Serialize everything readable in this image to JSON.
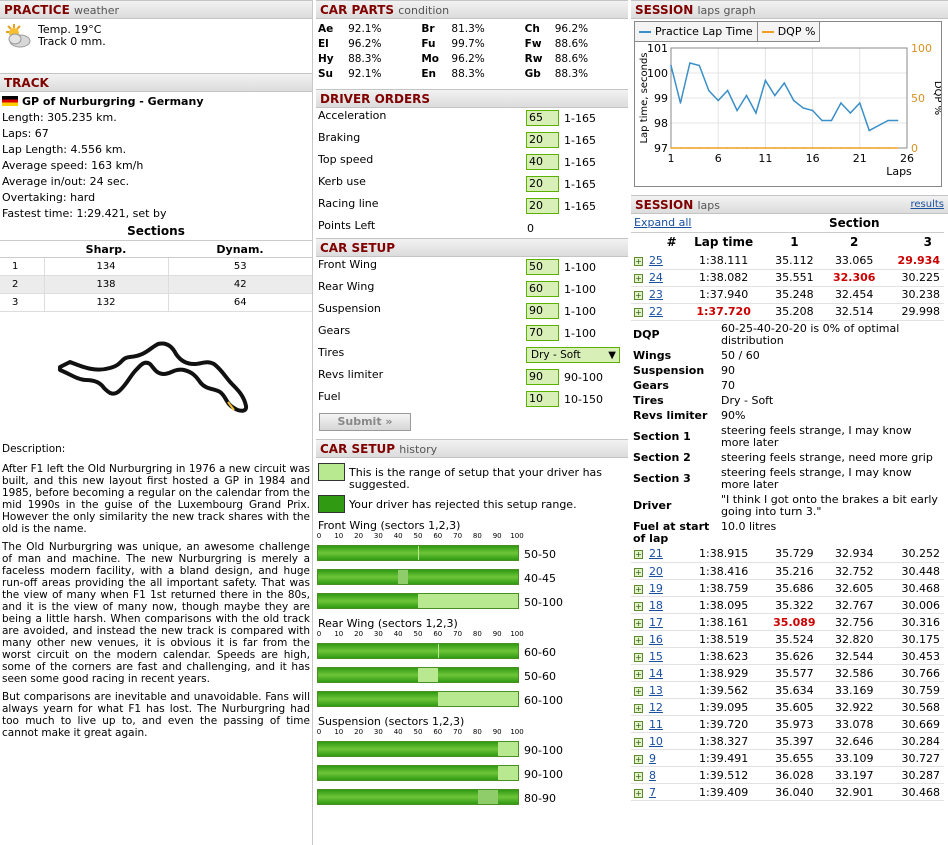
{
  "practice": {
    "title": "PRACTICE",
    "subtitle": "weather",
    "temp": "Temp. 19°C",
    "track": "Track 0 mm."
  },
  "track": {
    "title": "TRACK",
    "name": "GP of Nurburgring - Germany",
    "lines": [
      "Length: 305.235 km.",
      "Laps: 67",
      "Lap Length: 4.556 km.",
      "Average speed: 163 km/h",
      "Average in/out: 24 sec.",
      "Overtaking: hard",
      "Fastest time: 1:29.421, set by"
    ],
    "sections_title": "Sections",
    "sections_headers": [
      "",
      "Sharp.",
      "Dynam."
    ],
    "sections": [
      {
        "n": "1",
        "sharp": "134",
        "dynam": "53"
      },
      {
        "n": "2",
        "sharp": "138",
        "dynam": "42"
      },
      {
        "n": "3",
        "sharp": "132",
        "dynam": "64"
      }
    ],
    "description_label": "Description:",
    "description": [
      "After F1 left the Old Nurburgring in 1976 a new circuit was built, and this new layout first hosted a GP in 1984 and 1985, before becoming a regular on the calendar from the mid 1990s in the guise of the Luxembourg Grand Prix. However the only similarity the new track shares with the old is the name.",
      "The Old Nurburgring was unique, an awesome challenge of man and machine. The new Nurburgring is merely a faceless modern facility, with a bland design, and huge run-off areas providing the all important safety. That was the view of many when F1 1st returned there in the 80s, and it is the view of many now, though maybe they are being a little harsh. When comparisons with the old track are avoided, and instead the new track is compared with many other new venues, it is obvious it is far from the worst circuit on the modern calendar. Speeds are high, some of the corners are fast and challenging, and it has seen some good racing in recent years.",
      "But comparisons are inevitable and unavoidable. Fans will always yearn for what F1 has lost. The Nurburgring had too much to live up to, and even the passing of time cannot make it great again."
    ]
  },
  "car_parts": {
    "title": "CAR PARTS",
    "subtitle": "condition",
    "rows": [
      [
        {
          "k": "Ae",
          "v": "92.1%"
        },
        {
          "k": "Br",
          "v": "81.3%"
        },
        {
          "k": "Ch",
          "v": "96.2%"
        }
      ],
      [
        {
          "k": "El",
          "v": "96.2%"
        },
        {
          "k": "Fu",
          "v": "99.7%"
        },
        {
          "k": "Fw",
          "v": "88.6%"
        }
      ],
      [
        {
          "k": "Hy",
          "v": "88.3%"
        },
        {
          "k": "Mo",
          "v": "96.2%"
        },
        {
          "k": "Rw",
          "v": "88.6%"
        }
      ],
      [
        {
          "k": "Su",
          "v": "92.1%"
        },
        {
          "k": "En",
          "v": "88.3%"
        },
        {
          "k": "Gb",
          "v": "88.3%"
        }
      ]
    ]
  },
  "driver_orders": {
    "title": "DRIVER ORDERS",
    "rows": [
      {
        "label": "Acceleration",
        "value": "65",
        "range": "1-165"
      },
      {
        "label": "Braking",
        "value": "20",
        "range": "1-165"
      },
      {
        "label": "Top speed",
        "value": "40",
        "range": "1-165"
      },
      {
        "label": "Kerb use",
        "value": "20",
        "range": "1-165"
      },
      {
        "label": "Racing line",
        "value": "20",
        "range": "1-165"
      }
    ],
    "points_left_label": "Points Left",
    "points_left": "0"
  },
  "car_setup": {
    "title": "CAR SETUP",
    "rows": [
      {
        "label": "Front Wing",
        "value": "50",
        "range": "1-100"
      },
      {
        "label": "Rear Wing",
        "value": "60",
        "range": "1-100"
      },
      {
        "label": "Suspension",
        "value": "90",
        "range": "1-100"
      },
      {
        "label": "Gears",
        "value": "70",
        "range": "1-100"
      }
    ],
    "tires_label": "Tires",
    "tires_value": "Dry - Soft",
    "rows2": [
      {
        "label": "Revs limiter",
        "value": "90",
        "range": "90-100"
      },
      {
        "label": "Fuel",
        "value": "10",
        "range": "10-150"
      }
    ],
    "submit": "Submit »"
  },
  "setup_history": {
    "title": "CAR SETUP",
    "subtitle": "history",
    "legend_range": "This is the range of setup that your driver has suggested.",
    "legend_rejected": "Your driver has rejected this setup range.",
    "scale": [
      "0",
      "10",
      "20",
      "30",
      "40",
      "50",
      "60",
      "70",
      "80",
      "90",
      "100"
    ],
    "groups": [
      {
        "title": "Front Wing (sectors 1,2,3)",
        "bars": [
          {
            "label": "50-50",
            "range": [
              50,
              50
            ],
            "rejected": null
          },
          {
            "label": "40-45",
            "range": null,
            "rejected": [
              40,
              45
            ]
          },
          {
            "label": "50-100",
            "range": [
              50,
              100
            ],
            "rejected": null
          }
        ]
      },
      {
        "title": "Rear Wing (sectors 1,2,3)",
        "bars": [
          {
            "label": "60-60",
            "range": [
              60,
              60
            ],
            "rejected": null
          },
          {
            "label": "50-60",
            "range": [
              50,
              60
            ],
            "rejected": null
          },
          {
            "label": "60-100",
            "range": [
              60,
              100
            ],
            "rejected": null
          }
        ]
      },
      {
        "title": "Suspension (sectors 1,2,3)",
        "bars": [
          {
            "label": "90-100",
            "range": [
              90,
              100
            ],
            "rejected": null
          },
          {
            "label": "90-100",
            "range": [
              90,
              100
            ],
            "rejected": null
          },
          {
            "label": "80-90",
            "range": null,
            "rejected": [
              80,
              90
            ]
          }
        ]
      }
    ]
  },
  "session_graph": {
    "title": "SESSION",
    "subtitle": "laps graph",
    "legend": [
      {
        "name": "Practice Lap Time",
        "color": "#3a8fc8"
      },
      {
        "name": "DQP %",
        "color": "#f0a020"
      }
    ]
  },
  "chart_data": {
    "type": "line",
    "xlabel": "Laps",
    "ylabel": "Lap time, seconds",
    "y2label": "DQP %",
    "xlim": [
      1,
      26
    ],
    "ylim": [
      97,
      101
    ],
    "y2lim": [
      0,
      100
    ],
    "xticks": [
      1,
      6,
      11,
      16,
      21,
      26
    ],
    "yticks": [
      97,
      98,
      99,
      100,
      101
    ],
    "y2ticks": [
      0,
      50,
      100
    ],
    "series": [
      {
        "name": "Practice Lap Time",
        "axis": "left",
        "color": "#3a8fc8",
        "x": [
          1,
          2,
          3,
          4,
          5,
          6,
          7,
          8,
          9,
          10,
          11,
          12,
          13,
          14,
          15,
          16,
          17,
          18,
          19,
          20,
          21,
          22,
          23,
          24,
          25
        ],
        "y": [
          100.3,
          98.8,
          100.4,
          100.3,
          99.3,
          98.9,
          99.3,
          98.5,
          99.1,
          98.4,
          99.7,
          99.1,
          99.6,
          98.9,
          98.6,
          98.5,
          98.1,
          98.1,
          98.8,
          98.4,
          98.8,
          97.7,
          97.9,
          98.1,
          98.1
        ]
      },
      {
        "name": "DQP %",
        "axis": "right",
        "color": "#f0a020",
        "x": [
          1,
          2,
          3,
          4,
          5,
          6,
          7,
          8,
          9,
          10,
          11,
          12,
          13,
          14,
          15,
          16,
          17,
          18,
          19,
          20,
          21,
          22,
          23,
          24,
          25
        ],
        "y": [
          0,
          0,
          0,
          0,
          0,
          0,
          0,
          0,
          0,
          0,
          0,
          0,
          0,
          0,
          0,
          0,
          0,
          0,
          0,
          0,
          0,
          0,
          0,
          0,
          0
        ]
      }
    ]
  },
  "session_laps": {
    "title": "SESSION",
    "subtitle": "laps",
    "results_link": "results",
    "expand_all": "Expand all",
    "section_header": "Section",
    "headers": [
      "#",
      "Lap time",
      "1",
      "2",
      "3"
    ],
    "top": [
      {
        "lap": "25",
        "time": "1:38.111",
        "s1": "35.112",
        "s2": "33.065",
        "s3": "29.934",
        "best": "s3"
      },
      {
        "lap": "24",
        "time": "1:38.082",
        "s1": "35.551",
        "s2": "32.306",
        "s3": "30.225",
        "best": "s2"
      },
      {
        "lap": "23",
        "time": "1:37.940",
        "s1": "35.248",
        "s2": "32.454",
        "s3": "30.238",
        "best": ""
      },
      {
        "lap": "22",
        "time": "1:37.720",
        "s1": "35.208",
        "s2": "32.514",
        "s3": "29.998",
        "best": "time"
      }
    ],
    "details": [
      {
        "k": "DQP",
        "v": "60-25-40-20-20 is 0% of optimal distribution"
      },
      {
        "k": "Wings",
        "v": "50 / 60"
      },
      {
        "k": "Suspension",
        "v": "90"
      },
      {
        "k": "Gears",
        "v": "70"
      },
      {
        "k": "Tires",
        "v": "Dry - Soft"
      },
      {
        "k": "Revs limiter",
        "v": "90%"
      },
      {
        "k": "Section 1",
        "v": "steering feels strange, I may know more later"
      },
      {
        "k": "Section 2",
        "v": "steering feels strange, need more grip"
      },
      {
        "k": "Section 3",
        "v": "steering feels strange, I may know more later"
      },
      {
        "k": "Driver",
        "v": "\"I think I got onto the brakes a bit early going into turn 3.\""
      },
      {
        "k": "Fuel at start of lap",
        "v": "10.0 litres"
      }
    ],
    "rest": [
      {
        "lap": "21",
        "time": "1:38.915",
        "s1": "35.729",
        "s2": "32.934",
        "s3": "30.252",
        "best": ""
      },
      {
        "lap": "20",
        "time": "1:38.416",
        "s1": "35.216",
        "s2": "32.752",
        "s3": "30.448",
        "best": ""
      },
      {
        "lap": "19",
        "time": "1:38.759",
        "s1": "35.686",
        "s2": "32.605",
        "s3": "30.468",
        "best": ""
      },
      {
        "lap": "18",
        "time": "1:38.095",
        "s1": "35.322",
        "s2": "32.767",
        "s3": "30.006",
        "best": ""
      },
      {
        "lap": "17",
        "time": "1:38.161",
        "s1": "35.089",
        "s2": "32.756",
        "s3": "30.316",
        "best": "s1"
      },
      {
        "lap": "16",
        "time": "1:38.519",
        "s1": "35.524",
        "s2": "32.820",
        "s3": "30.175",
        "best": ""
      },
      {
        "lap": "15",
        "time": "1:38.623",
        "s1": "35.626",
        "s2": "32.544",
        "s3": "30.453",
        "best": ""
      },
      {
        "lap": "14",
        "time": "1:38.929",
        "s1": "35.577",
        "s2": "32.586",
        "s3": "30.766",
        "best": ""
      },
      {
        "lap": "13",
        "time": "1:39.562",
        "s1": "35.634",
        "s2": "33.169",
        "s3": "30.759",
        "best": ""
      },
      {
        "lap": "12",
        "time": "1:39.095",
        "s1": "35.605",
        "s2": "32.922",
        "s3": "30.568",
        "best": ""
      },
      {
        "lap": "11",
        "time": "1:39.720",
        "s1": "35.973",
        "s2": "33.078",
        "s3": "30.669",
        "best": ""
      },
      {
        "lap": "10",
        "time": "1:38.327",
        "s1": "35.397",
        "s2": "32.646",
        "s3": "30.284",
        "best": ""
      },
      {
        "lap": "9",
        "time": "1:39.491",
        "s1": "35.655",
        "s2": "33.109",
        "s3": "30.727",
        "best": ""
      },
      {
        "lap": "8",
        "time": "1:39.512",
        "s1": "36.028",
        "s2": "33.197",
        "s3": "30.287",
        "best": ""
      },
      {
        "lap": "7",
        "time": "1:39.409",
        "s1": "36.040",
        "s2": "32.901",
        "s3": "30.468",
        "best": ""
      }
    ]
  }
}
